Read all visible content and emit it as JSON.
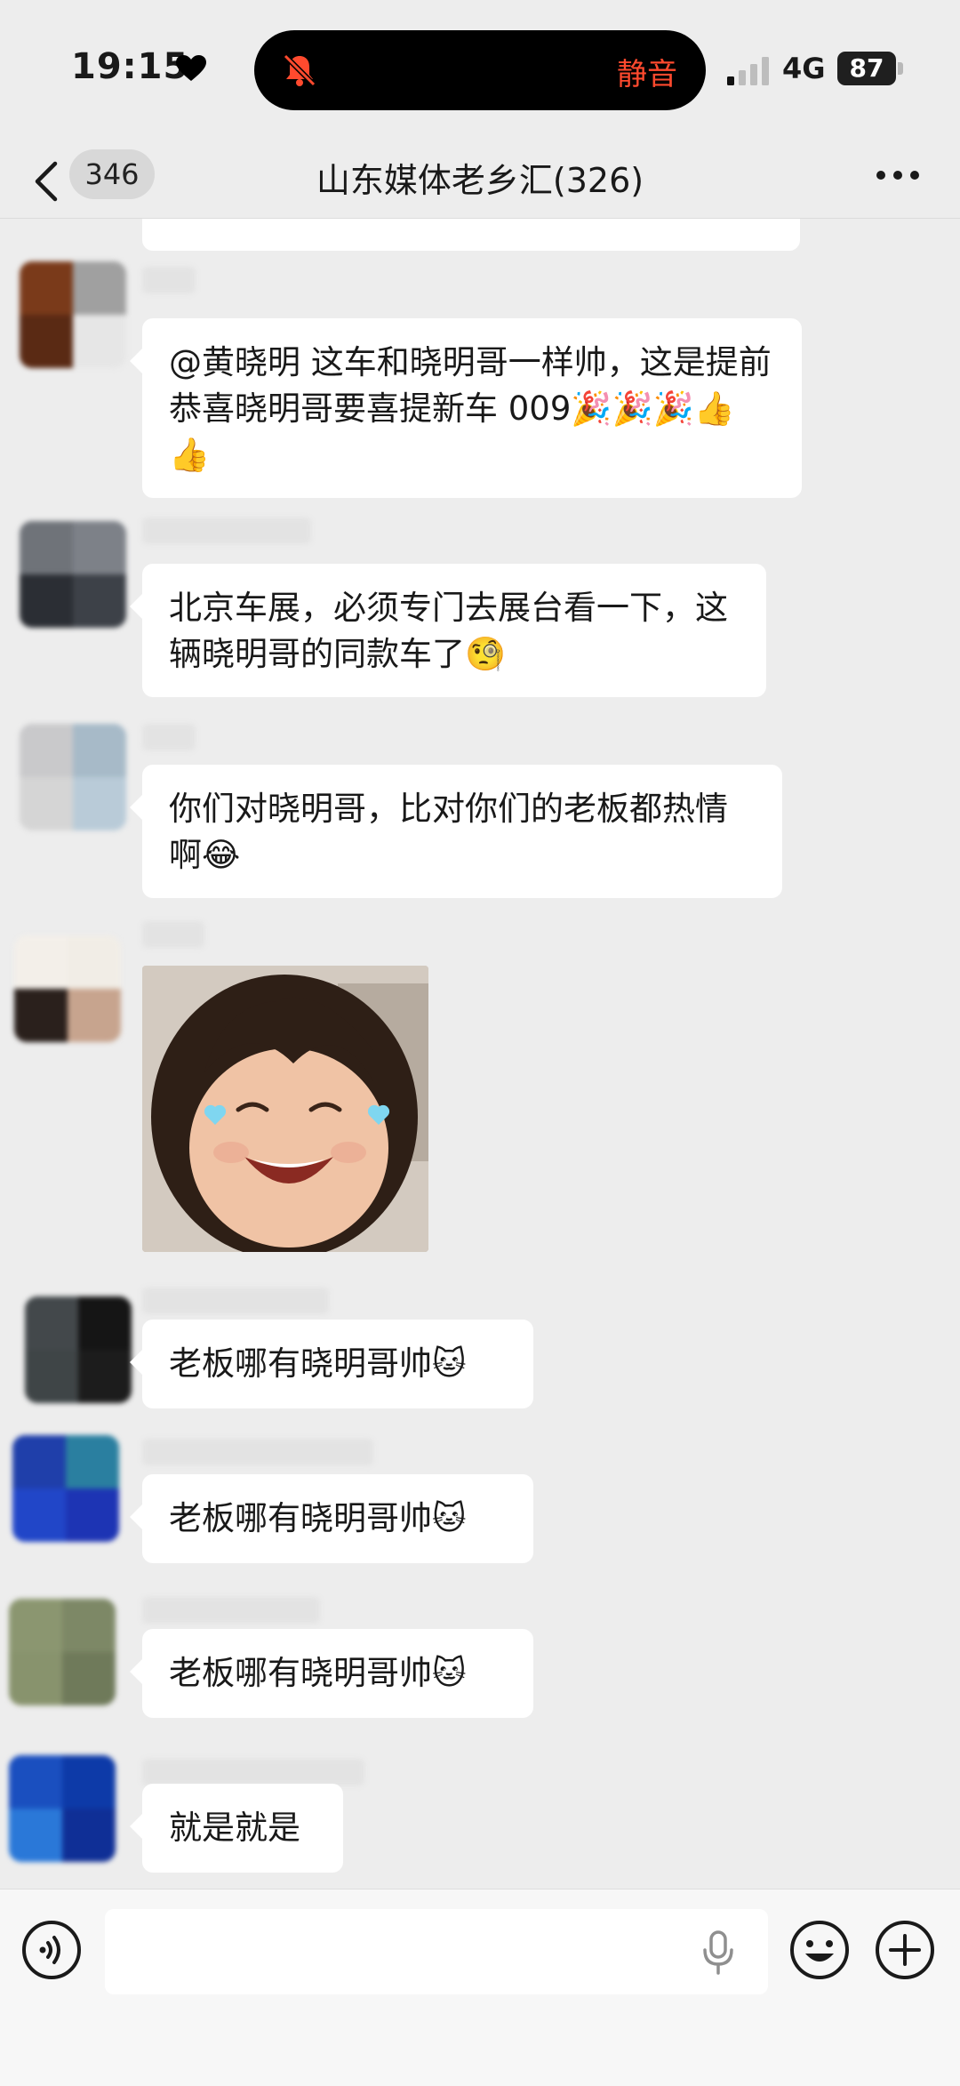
{
  "status_bar": {
    "time": "19:15",
    "island_label": "静音",
    "network": "4G",
    "battery": "87",
    "icons": [
      "heart-icon",
      "bell-muted-icon",
      "signal-icon",
      "battery-icon"
    ]
  },
  "nav": {
    "unread_count": "346",
    "title": "山东媒体老乡汇(326)",
    "icons": [
      "back-chevron-icon",
      "more-icon"
    ]
  },
  "messages": [
    {
      "type": "text",
      "text": "@黄晓明 这车和晓明哥一样帅，这是提前恭喜晓明哥要喜提新车 009🎉🎉🎉👍👍"
    },
    {
      "type": "text",
      "text": "北京车展，必须专门去展台看一下，这辆晓明哥的同款车了🧐"
    },
    {
      "type": "text",
      "text": "你们对晓明哥，比对你们的老板都热情啊😂"
    },
    {
      "type": "sticker",
      "description": "smiling-girl-sticker"
    },
    {
      "type": "text",
      "text": "老板哪有晓明哥帅🐱"
    },
    {
      "type": "text",
      "text": "老板哪有晓明哥帅🐱"
    },
    {
      "type": "text",
      "text": "老板哪有晓明哥帅🐱"
    },
    {
      "type": "text",
      "text": "就是就是"
    }
  ],
  "input_bar": {
    "placeholder": "",
    "icons": [
      "voice-toggle-icon",
      "mic-icon",
      "emoji-icon",
      "plus-icon"
    ]
  },
  "colors": {
    "background": "#ededed",
    "bubble": "#ffffff",
    "mute_text": "#ff4a2e"
  }
}
